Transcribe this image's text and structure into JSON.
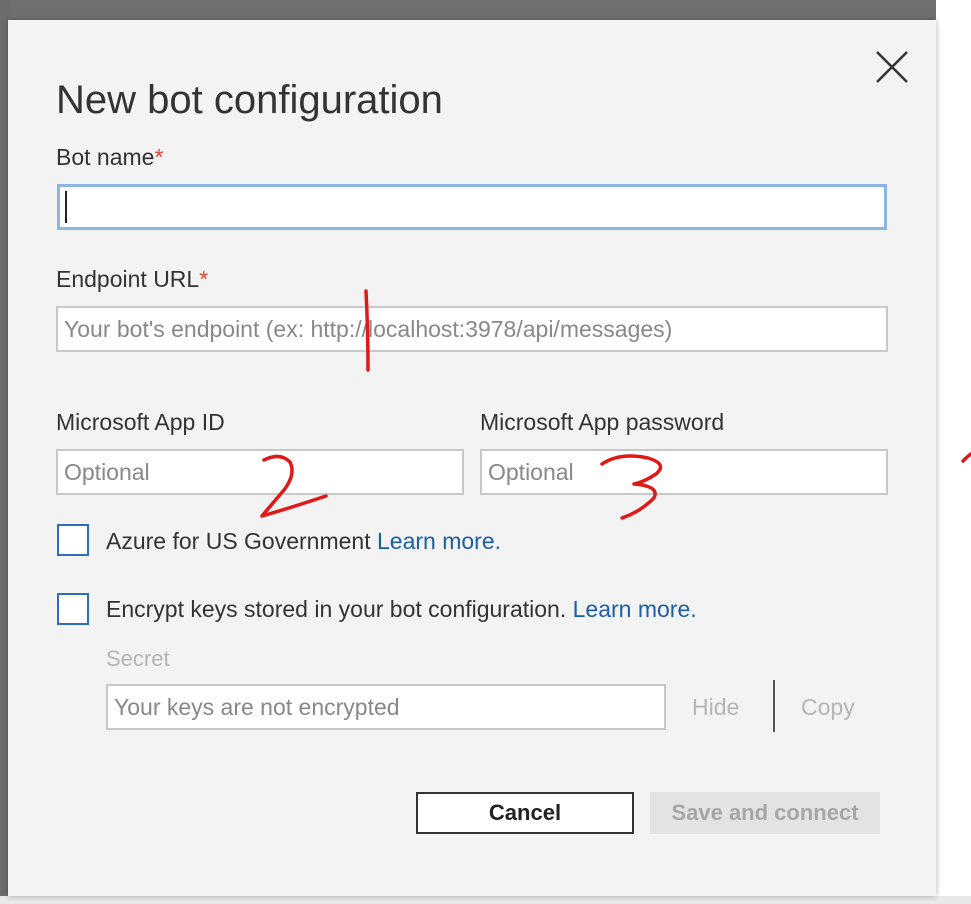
{
  "dialog": {
    "title": "New bot configuration",
    "close_icon": "close-icon",
    "bot_name": {
      "label": "Bot name",
      "required_mark": "*",
      "value": ""
    },
    "endpoint_url": {
      "label": "Endpoint URL",
      "required_mark": "*",
      "placeholder": "Your bot's endpoint (ex: http://localhost:3978/api/messages)"
    },
    "app_id": {
      "label": "Microsoft App ID",
      "placeholder": "Optional"
    },
    "app_password": {
      "label": "Microsoft App password",
      "placeholder": "Optional"
    },
    "azure_gov": {
      "label": "Azure for US Government",
      "link": "Learn more.",
      "checked": false
    },
    "encrypt": {
      "label": "Encrypt keys stored in your bot configuration.",
      "link": "Learn more.",
      "checked": false
    },
    "secret": {
      "label": "Secret",
      "placeholder": "Your keys are not encrypted",
      "hide_label": "Hide",
      "copy_label": "Copy"
    },
    "cancel_label": "Cancel",
    "save_label": "Save and connect"
  },
  "annotations": [
    "1",
    "2",
    "3"
  ],
  "colors": {
    "accent": "#2f6db8",
    "link": "#1c5ea3",
    "required": "#e8433a",
    "annotation": "#e01818"
  }
}
